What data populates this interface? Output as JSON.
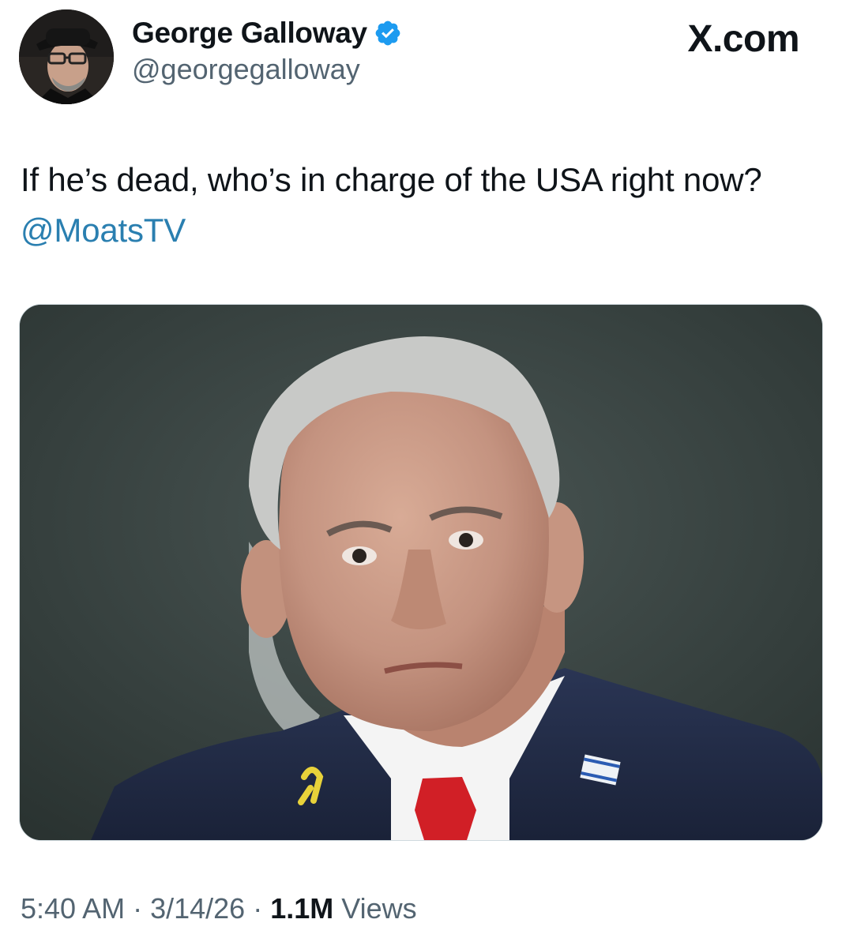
{
  "author": {
    "display_name": "George Galloway",
    "handle": "@georgegalloway",
    "verified": true,
    "avatar_icon": "profile-photo"
  },
  "branding": {
    "site": "X.com"
  },
  "tweet": {
    "text_main": "If he’s dead, who’s in charge of the USA right now? ",
    "mention": "@MoatsTV",
    "image_description_icon": "photo-man-in-suit"
  },
  "metadata": {
    "time": "5:40 AM",
    "separator": "·",
    "date": "3/14/26",
    "views_count": "1.1M",
    "views_label": "Views"
  },
  "colors": {
    "mention": "#2a7fb0",
    "verified_badge": "#1d9bf0",
    "secondary_text": "#536471",
    "primary_text": "#0f1419"
  }
}
